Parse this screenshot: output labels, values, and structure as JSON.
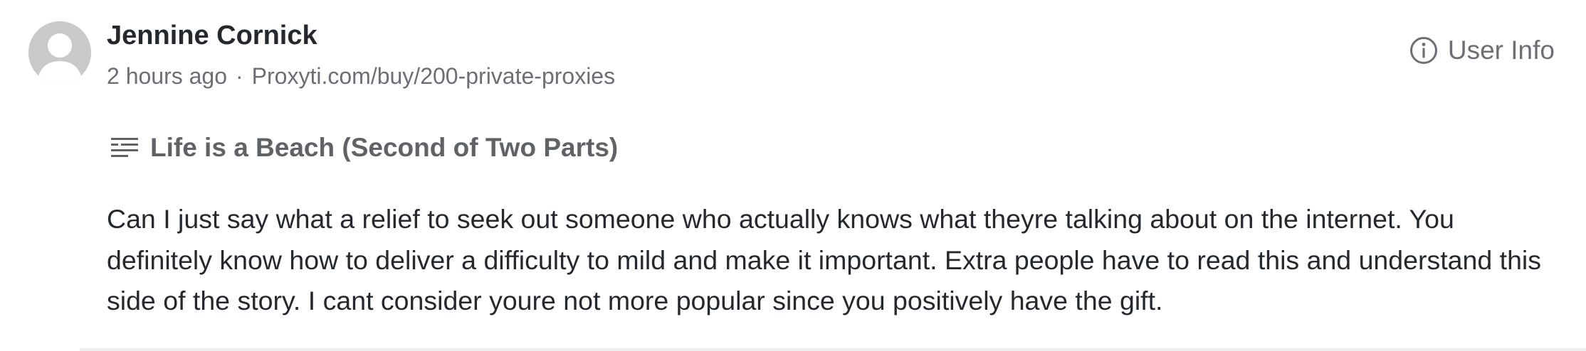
{
  "comment": {
    "author": "Jennine Cornick",
    "timestamp": "2 hours ago",
    "separator": "·",
    "source_link": "Proxyti.com/buy/200-private-proxies",
    "user_info_label": "User Info",
    "post_title": "Life is a Beach (Second of Two Parts)",
    "body": "Can I just say what a relief to seek out someone who actually knows what theyre talking about on the internet. You definitely know how to deliver a difficulty to mild and make it important. Extra people have to read this and understand this side of the story. I cant consider youre not more popular since you positively have the gift."
  },
  "icons": {
    "avatar": "user-silhouette-icon",
    "user_info": "info-circle-icon",
    "title": "notes-lines-icon"
  },
  "colors": {
    "avatar_bg": "#c9c9c9",
    "muted_text": "#6b6f75",
    "body_text": "#24292f"
  }
}
